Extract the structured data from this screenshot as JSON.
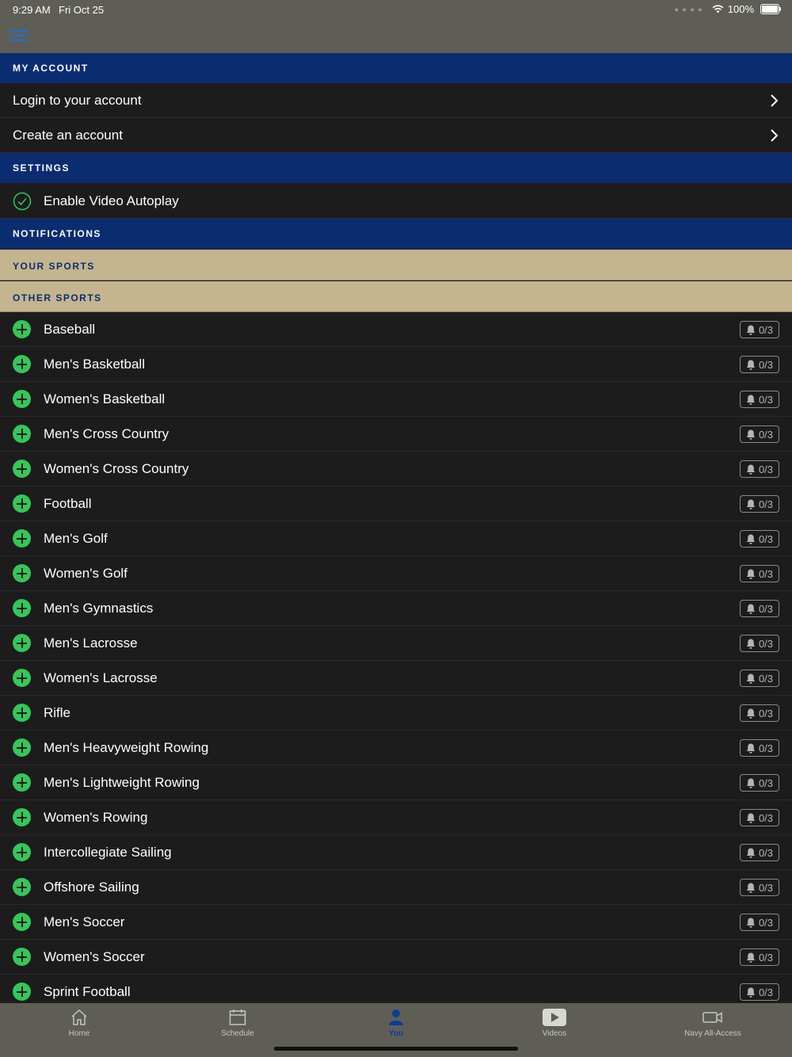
{
  "status_bar": {
    "time": "9:29 AM",
    "date": "Fri Oct 25",
    "battery": "100%"
  },
  "sections": {
    "my_account": "MY ACCOUNT",
    "settings": "SETTINGS",
    "notifications": "NOTIFICATIONS",
    "your_sports": "YOUR SPORTS",
    "other_sports": "OTHER SPORTS"
  },
  "account_items": {
    "login": "Login to your account",
    "create": "Create an account"
  },
  "settings_items": {
    "autoplay": "Enable Video Autoplay"
  },
  "sports": [
    {
      "name": "Baseball",
      "count": "0/3"
    },
    {
      "name": "Men's Basketball",
      "count": "0/3"
    },
    {
      "name": "Women's Basketball",
      "count": "0/3"
    },
    {
      "name": "Men's Cross Country",
      "count": "0/3"
    },
    {
      "name": "Women's Cross Country",
      "count": "0/3"
    },
    {
      "name": "Football",
      "count": "0/3"
    },
    {
      "name": "Men's Golf",
      "count": "0/3"
    },
    {
      "name": "Women's Golf",
      "count": "0/3"
    },
    {
      "name": "Men's Gymnastics",
      "count": "0/3"
    },
    {
      "name": "Men's Lacrosse",
      "count": "0/3"
    },
    {
      "name": "Women's Lacrosse",
      "count": "0/3"
    },
    {
      "name": "Rifle",
      "count": "0/3"
    },
    {
      "name": "Men's Heavyweight Rowing",
      "count": "0/3"
    },
    {
      "name": "Men's Lightweight Rowing",
      "count": "0/3"
    },
    {
      "name": "Women's Rowing",
      "count": "0/3"
    },
    {
      "name": "Intercollegiate Sailing",
      "count": "0/3"
    },
    {
      "name": "Offshore Sailing",
      "count": "0/3"
    },
    {
      "name": "Men's Soccer",
      "count": "0/3"
    },
    {
      "name": "Women's Soccer",
      "count": "0/3"
    },
    {
      "name": "Sprint Football",
      "count": "0/3"
    }
  ],
  "tabs": [
    {
      "label": "Home",
      "icon": "home-icon"
    },
    {
      "label": "Schedule",
      "icon": "calendar-icon"
    },
    {
      "label": "You",
      "icon": "person-icon"
    },
    {
      "label": "Videos",
      "icon": "play-icon"
    },
    {
      "label": "Navy All-Access",
      "icon": "video-camera-icon"
    }
  ],
  "colors": {
    "section_header": "#0a2d72",
    "sub_header": "#c4b58f",
    "accent_green": "#34c759",
    "active_tab": "#0a3d9a"
  }
}
